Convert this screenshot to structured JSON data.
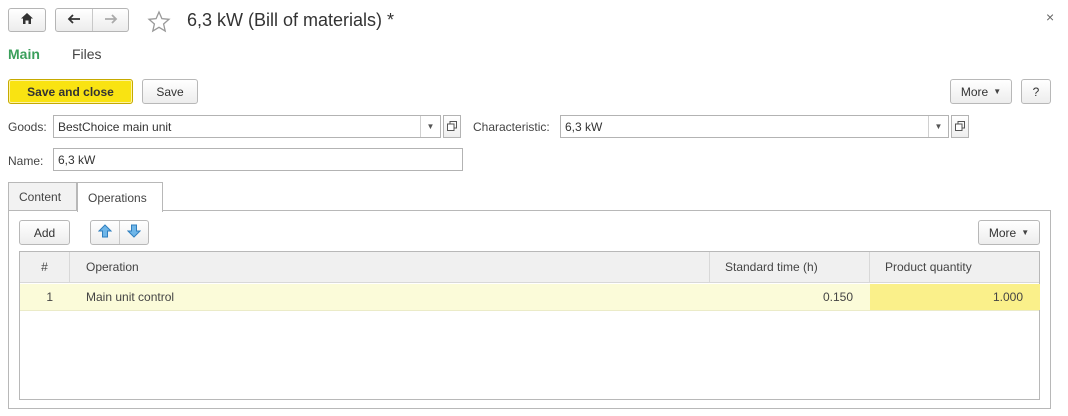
{
  "window": {
    "title": "6,3 kW (Bill of materials) *",
    "home_icon": "home-icon",
    "back_icon": "arrow-left-icon",
    "forward_icon": "arrow-right-icon",
    "favorite_icon": "star-outline-icon",
    "close_icon": "close-icon",
    "close_glyph": "×"
  },
  "sections": [
    {
      "label": "Main",
      "active": true
    },
    {
      "label": "Files",
      "active": false
    }
  ],
  "toolbar": {
    "save_and_close": "Save and close",
    "save": "Save",
    "more": "More",
    "help": "?"
  },
  "form": {
    "goods_label": "Goods:",
    "goods_value": "BestChoice main unit",
    "characteristic_label": "Characteristic:",
    "characteristic_value": "6,3 kW",
    "name_label": "Name:",
    "name_value": "6,3 kW"
  },
  "tabs": [
    {
      "label": "Content",
      "active": false
    },
    {
      "label": "Operations",
      "active": true
    }
  ],
  "operations": {
    "add": "Add",
    "move_up_icon": "arrow-up-icon",
    "move_down_icon": "arrow-down-icon",
    "more": "More",
    "columns": [
      "#",
      "Operation",
      "Standard time (h)",
      "Product quantity"
    ],
    "rows": [
      {
        "num": "1",
        "operation": "Main unit control",
        "standard_time": "0.150",
        "product_quantity": "1.000"
      }
    ]
  },
  "colors": {
    "accent_green": "#3a9f5b",
    "primary_button": "#f9e312",
    "row_highlight": "#fbfbd9",
    "cell_highlight": "#faf08a"
  }
}
